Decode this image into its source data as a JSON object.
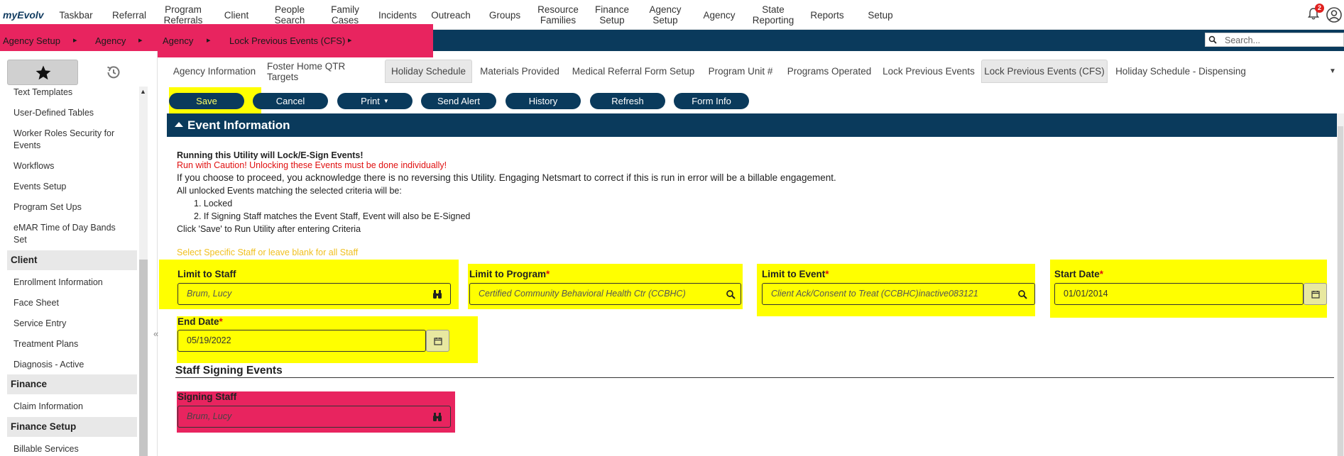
{
  "brand": "myEvolv",
  "nav": [
    {
      "label": "Taskbar"
    },
    {
      "label": "Referral"
    },
    {
      "label": "Program\nReferrals"
    },
    {
      "label": "Client"
    },
    {
      "label": "People\nSearch"
    },
    {
      "label": "Family Cases"
    },
    {
      "label": "Incidents"
    },
    {
      "label": "Outreach"
    },
    {
      "label": "Groups"
    },
    {
      "label": "Resource\nFamilies"
    },
    {
      "label": "Finance\nSetup"
    },
    {
      "label": "Agency\nSetup"
    },
    {
      "label": "Agency"
    },
    {
      "label": "State\nReporting"
    },
    {
      "label": "Reports"
    },
    {
      "label": "Setup"
    }
  ],
  "notifications": {
    "count": "2"
  },
  "breadcrumbs": [
    "Agency Setup",
    "Agency",
    "Agency",
    "Lock Previous Events (CFS)"
  ],
  "search": {
    "placeholder": "Search..."
  },
  "sidebar": {
    "items": [
      {
        "label": "Text Templates"
      },
      {
        "label": "User-Defined Tables"
      },
      {
        "label": "Worker Roles Security for Events"
      },
      {
        "label": "Workflows"
      },
      {
        "label": "Events Setup"
      },
      {
        "label": "Program Set Ups"
      },
      {
        "label": "eMAR Time of Day Bands Set"
      }
    ],
    "client_header": "Client",
    "client_items": [
      {
        "label": "Enrollment Information"
      },
      {
        "label": "Face Sheet"
      },
      {
        "label": "Service Entry"
      },
      {
        "label": "Treatment Plans"
      },
      {
        "label": "Diagnosis - Active"
      }
    ],
    "finance_header": "Finance",
    "finance_items": [
      {
        "label": "Claim Information"
      }
    ],
    "finance_setup_header": "Finance Setup",
    "finance_setup_items": [
      {
        "label": "Billable Services"
      }
    ]
  },
  "tabs": [
    {
      "label": "Agency Information",
      "active": false
    },
    {
      "label": "Foster Home QTR Targets",
      "active": false
    },
    {
      "label": "Holiday Schedule",
      "active": true
    },
    {
      "label": "Materials Provided",
      "active": false
    },
    {
      "label": "Medical Referral Form Setup",
      "active": false
    },
    {
      "label": "Program Unit #",
      "active": false
    },
    {
      "label": "Programs Operated",
      "active": false
    },
    {
      "label": "Lock Previous Events",
      "active": false
    },
    {
      "label": "Lock Previous Events (CFS)",
      "active": true
    },
    {
      "label": "Holiday Schedule - Dispensing",
      "active": false
    }
  ],
  "buttons": {
    "save": "Save",
    "cancel": "Cancel",
    "print": "Print",
    "send_alert": "Send Alert",
    "history": "History",
    "refresh": "Refresh",
    "form_info": "Form Info"
  },
  "section": {
    "title": "Event Information"
  },
  "info": {
    "line1": "Running this Utility will Lock/E-Sign Events!",
    "line2": "Run with Caution!  Unlocking these Events must be done individually!",
    "line3": "If you choose to proceed, you acknowledge there is no reversing this Utility.  Engaging Netsmart to correct if this is run in error will be a billable engagement.",
    "line4": "All unlocked Events matching the selected criteria will be:",
    "item1": "1. Locked",
    "item2": "2. If Signing Staff matches the Event Staff, Event will also be E-Signed",
    "line5": "Click 'Save' to Run Utility after entering Criteria",
    "hint": "Select Specific Staff or leave blank for all Staff"
  },
  "fields": {
    "limit_staff": {
      "label": "Limit to Staff",
      "value": "Brum, Lucy"
    },
    "limit_program": {
      "label": "Limit to Program",
      "value": "Certified Community Behavioral Health Ctr (CCBHC)"
    },
    "limit_event": {
      "label": "Limit to Event",
      "value": "Client Ack/Consent to Treat (CCBHC)inactive083121"
    },
    "start_date": {
      "label": "Start Date",
      "value": "01/01/2014"
    },
    "end_date": {
      "label": "End Date",
      "value": "05/19/2022"
    }
  },
  "required_mark": "*",
  "staff_signing": {
    "title": "Staff Signing Events",
    "label": "Signing Staff",
    "value": "Brum, Lucy"
  },
  "colors": {
    "navy": "#0a3a5c",
    "highlight_yellow": "#ffff00",
    "highlight_pink": "#e8245f",
    "required_red": "#e01010"
  }
}
